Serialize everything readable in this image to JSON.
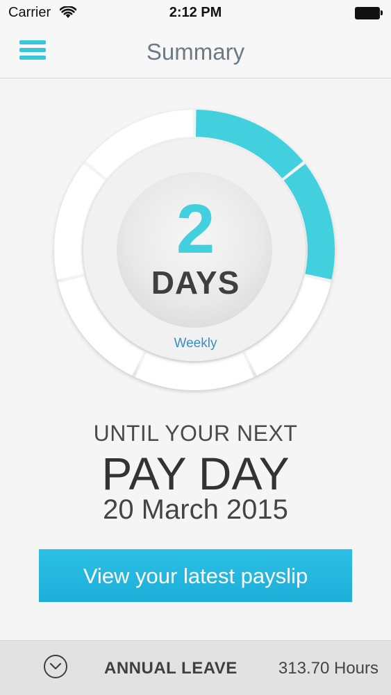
{
  "status_bar": {
    "carrier": "Carrier",
    "time": "2:12 PM",
    "wifi_icon": "wifi-icon",
    "battery_icon": "battery-full-icon"
  },
  "nav": {
    "title": "Summary",
    "menu_icon": "hamburger-menu-icon"
  },
  "countdown": {
    "number": "2",
    "unit": "DAYS",
    "frequency": "Weekly",
    "segments_total": 7,
    "segments_filled": 2
  },
  "payday": {
    "line1": "UNTIL YOUR NEXT",
    "line2": "PAY DAY",
    "date": "20 March 2015"
  },
  "payslip_button": {
    "label": "View your latest payslip"
  },
  "annual_leave": {
    "label": "ANNUAL LEAVE",
    "value": "313.70 Hours",
    "toggle_icon": "chevron-down-circle-icon"
  },
  "colors": {
    "accent": "#43d0de",
    "button": "#1eb2dc",
    "frequency_text": "#3a8fbe"
  }
}
